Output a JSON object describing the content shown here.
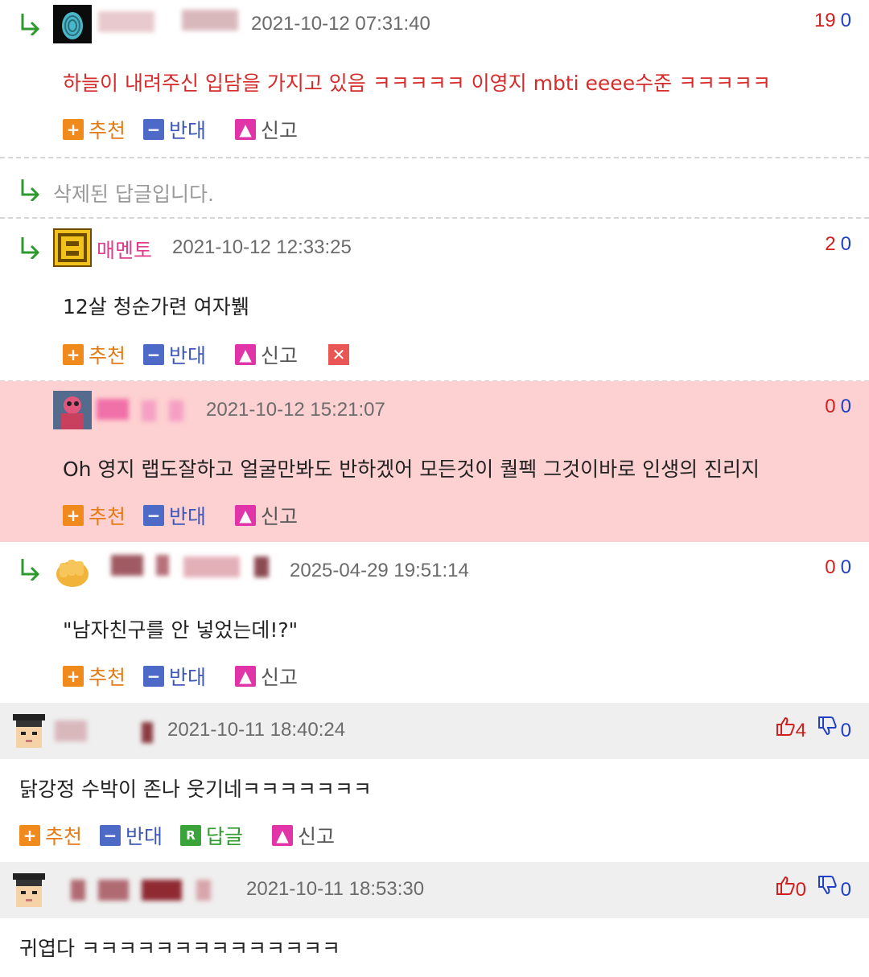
{
  "comments": [
    {
      "time": "2021-10-12 07:31:40",
      "up": "19",
      "down": "0",
      "text": "하늘이 내려주신 입담을 가지고 있음 ㅋㅋㅋㅋㅋ 이영지 mbti eeee수준 ㅋㅋㅋㅋㅋ"
    },
    {
      "deleted_text": "삭제된 답글입니다."
    },
    {
      "nickname": "매멘토",
      "time": "2021-10-12 12:33:25",
      "up": "2",
      "down": "0",
      "text": "12살 청순가련 여자뷁"
    },
    {
      "time": "2021-10-12 15:21:07",
      "up": "0",
      "down": "0",
      "text": "Oh 영지 랩도잘하고 얼굴만봐도 반하겠어 모든것이 퀄펙 그것이바로 인생의 진리지"
    },
    {
      "time": "2025-04-29 19:51:14",
      "up": "0",
      "down": "0",
      "text": "\"남자친구를 안 넣었는데!?\""
    },
    {
      "time": "2021-10-11 18:40:24",
      "up": "4",
      "down": "0",
      "text": "닭강정 수박이 존나 웃기네ㅋㅋㅋㅋㅋㅋㅋ"
    },
    {
      "time": "2021-10-11 18:53:30",
      "up": "0",
      "down": "0",
      "text": "귀엽다 ㅋㅋㅋㅋㅋㅋㅋㅋㅋㅋㅋㅋㅋㅋ"
    }
  ],
  "actions": {
    "recommend": "추천",
    "oppose": "반대",
    "reply": "답글",
    "report": "신고"
  },
  "icons": {
    "recommend": "plus-icon",
    "oppose": "minus-icon",
    "reply": "reply-icon",
    "report": "siren-icon",
    "reply_arrow": "reply-arrow-icon",
    "delete": "close-icon",
    "upvote": "thumbs-up-icon",
    "downvote": "thumbs-down-icon"
  },
  "colors": {
    "upvote": "#d11f1f",
    "downvote": "#1f3fc4",
    "recommend": "#e57b16",
    "oppose": "#3d58b8",
    "reply": "#2f9a2f",
    "highlight_bg": "#fdd0d1",
    "best_comment_header_bg": "#efefef",
    "nickname": "#e03c8a",
    "red_text": "#d62b2b"
  }
}
